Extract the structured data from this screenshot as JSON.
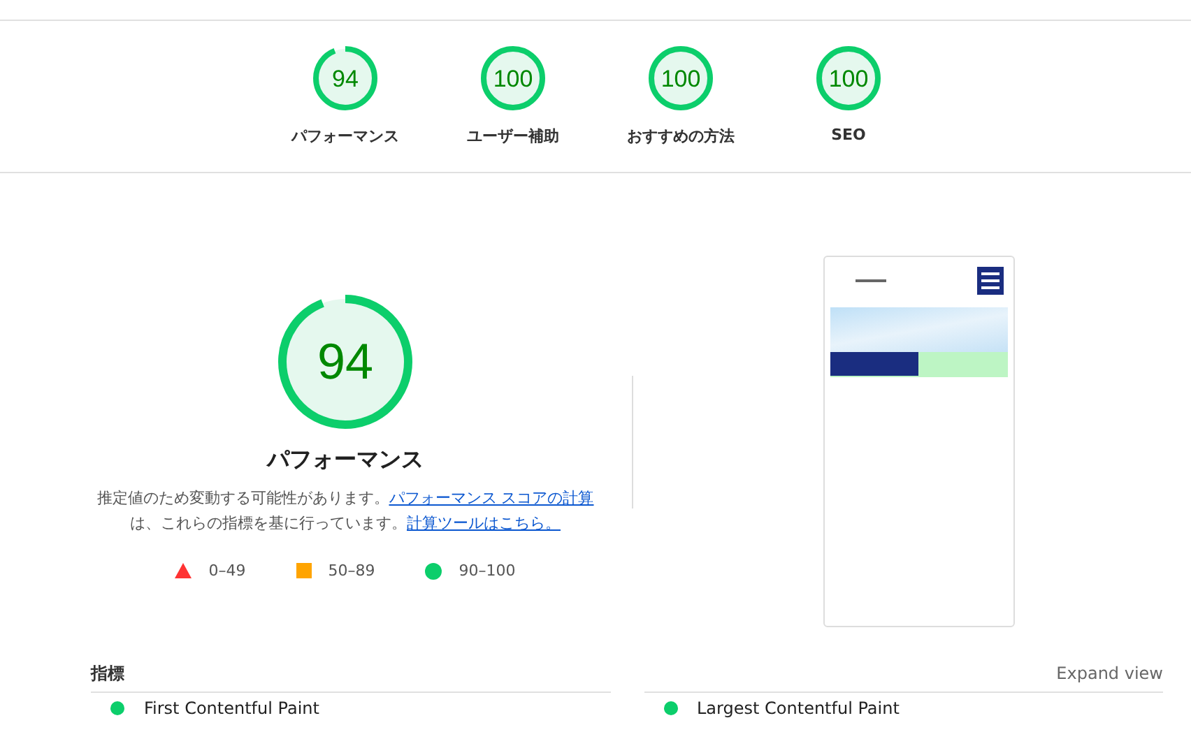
{
  "categories": [
    {
      "score": "94",
      "label": "パフォーマンス",
      "level": 0.94
    },
    {
      "score": "100",
      "label": "ユーザー補助",
      "level": 1
    },
    {
      "score": "100",
      "label": "おすすめの方法",
      "level": 1
    },
    {
      "score": "100",
      "label": "SEO",
      "level": 1
    }
  ],
  "main": {
    "score": "94",
    "level": 0.94,
    "title": "パフォーマンス",
    "description": [
      {
        "kind": "text",
        "text": "推定値のため変動する可能性があります。"
      },
      {
        "kind": "link",
        "text": "パフォーマンス スコアの計算"
      },
      {
        "kind": "text",
        "text": "は、これらの指標を基に行っています。"
      },
      {
        "kind": "link",
        "text": "計算ツールはこちら。"
      }
    ],
    "legend": [
      {
        "kind": "triangle",
        "color": "#ff3333",
        "range": "0–49"
      },
      {
        "kind": "square",
        "color": "#ffa400",
        "range": "50–89"
      },
      {
        "kind": "circle",
        "color": "#0cce6b",
        "range": "90–100"
      }
    ]
  },
  "metrics": {
    "title": "指標",
    "expand": "Expand view",
    "items": [
      {
        "name": "First Contentful Paint",
        "color": "#0cce6b"
      },
      {
        "name": "Largest Contentful Paint",
        "color": "#0cce6b"
      }
    ]
  }
}
